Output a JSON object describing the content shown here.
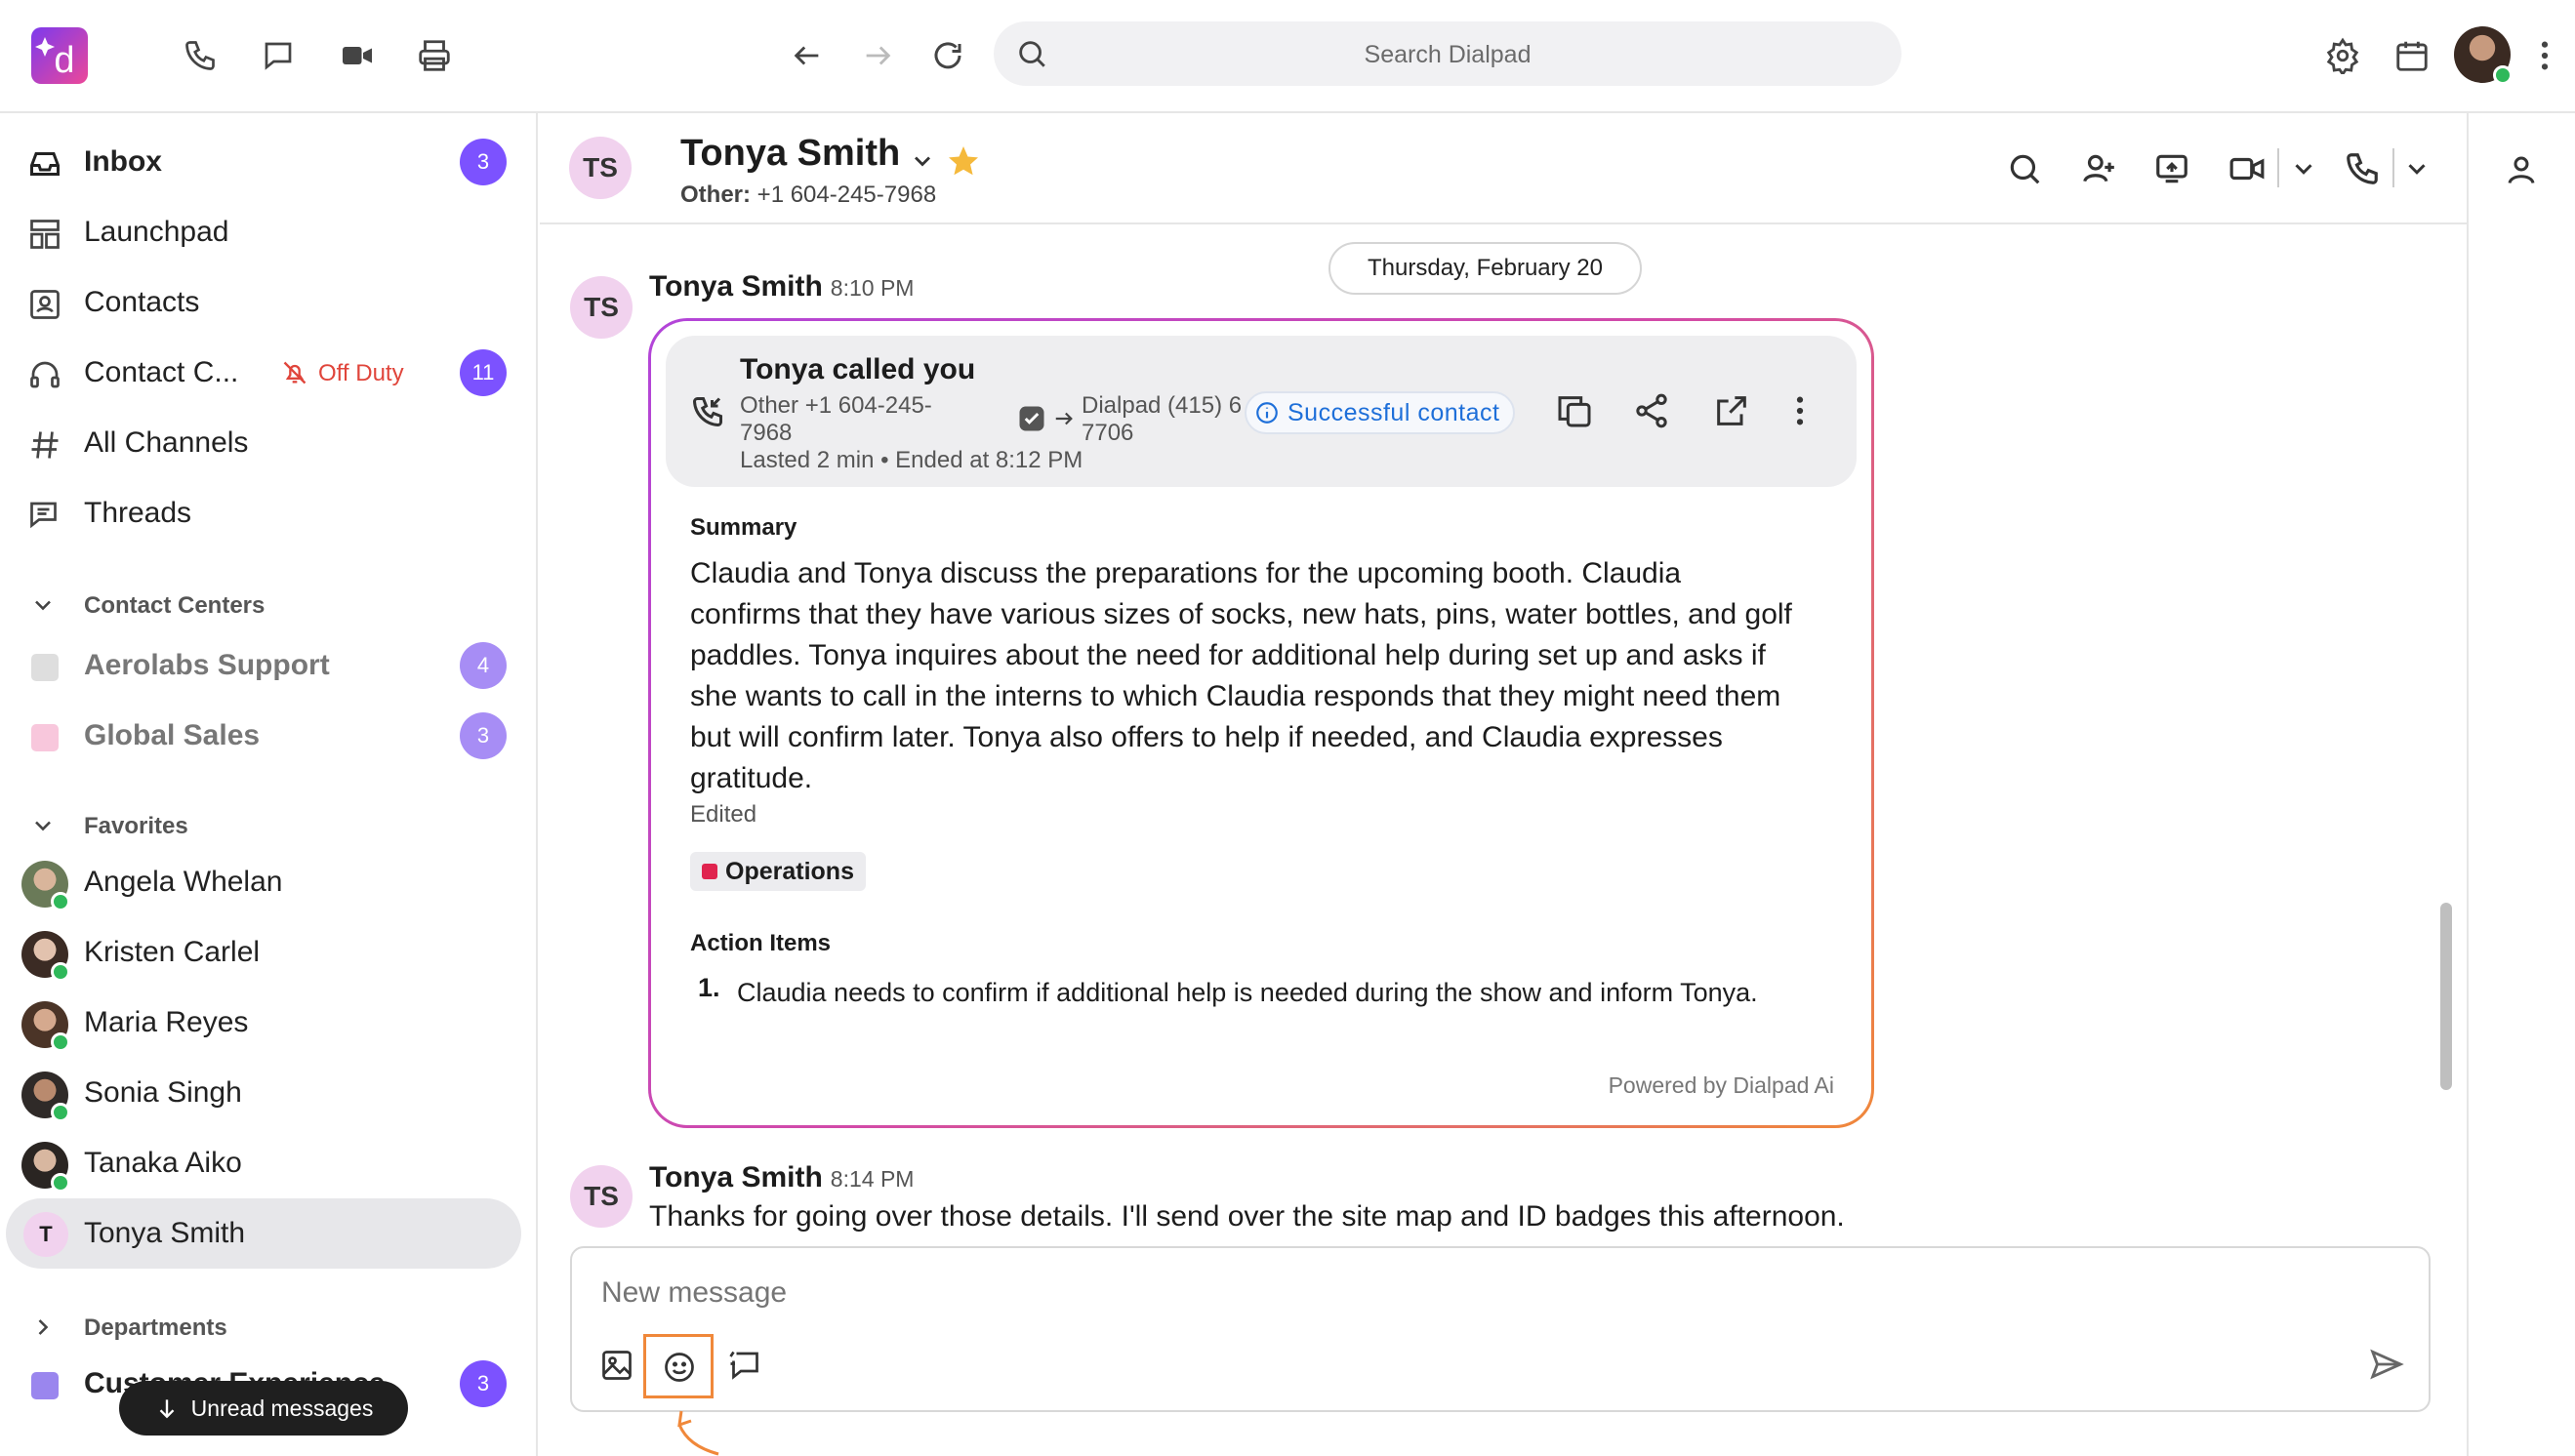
{
  "search": {
    "placeholder": "Search Dialpad"
  },
  "colors": {
    "accent": "#7c52ff",
    "online": "#2fb85a",
    "off_duty": "#e0453b",
    "success": "#1e6fd9",
    "highlight": "#f0883a"
  },
  "icons": {
    "top_left": [
      "dialpad-logo-icon",
      "phone-icon",
      "message-icon",
      "video-icon",
      "print-icon"
    ],
    "nav": [
      "back-arrow-icon",
      "forward-arrow-icon",
      "refresh-icon",
      "search-icon"
    ],
    "top_right": [
      "settings-icon",
      "calendar-icon",
      "user-avatar",
      "more-vertical-icon"
    ]
  },
  "sidebar": {
    "nav": [
      {
        "label": "Inbox",
        "badge": "3",
        "bold": true
      },
      {
        "label": "Launchpad"
      },
      {
        "label": "Contacts"
      },
      {
        "label": "Contact C...",
        "status": "Off Duty",
        "badge": "11"
      },
      {
        "label": "All Channels"
      },
      {
        "label": "Threads"
      }
    ],
    "contact_centers": {
      "title": "Contact Centers",
      "items": [
        {
          "label": "Aerolabs Support",
          "badge": "4",
          "color": "#dedede"
        },
        {
          "label": "Global Sales",
          "badge": "3",
          "color": "#f8c7dc"
        }
      ]
    },
    "favorites": {
      "title": "Favorites",
      "items": [
        {
          "label": "Angela Whelan"
        },
        {
          "label": "Kristen Carlel"
        },
        {
          "label": "Maria Reyes"
        },
        {
          "label": "Sonia Singh"
        },
        {
          "label": "Tanaka Aiko"
        },
        {
          "label": "Tonya Smith",
          "initial": "T",
          "selected": true
        }
      ]
    },
    "departments": {
      "title": "Departments",
      "items": [
        {
          "label": "Customer Experience",
          "badge": "3",
          "color": "#9a86ee"
        }
      ]
    },
    "unread_pill": "Unread messages"
  },
  "header": {
    "initials": "TS",
    "name": "Tonya Smith",
    "sub_label": "Other:",
    "sub_value": "+1 604-245-7968"
  },
  "chat": {
    "date_chip": "Thursday, February 20",
    "messages": [
      {
        "initials": "TS",
        "name": "Tonya Smith",
        "time": "8:10 PM"
      },
      {
        "initials": "TS",
        "name": "Tonya Smith",
        "time": "8:14 PM",
        "text": "Thanks for going over those details. I'll send over the site map and ID badges this afternoon."
      }
    ],
    "call_card": {
      "title": "Tonya called you",
      "from_line1": "Other +1 604-245-",
      "from_line2": "7968",
      "to_line1": "Dialpad (415) 6",
      "to_line2": "7706",
      "duration": "Lasted 2 min • Ended at 8:12 PM",
      "status": "Successful contact",
      "summary_title": "Summary",
      "summary": "Claudia and Tonya discuss the preparations for the upcoming booth. Claudia confirms that they have various sizes of socks, new hats, pins, water bottles, and golf paddles. Tonya inquires about the need for additional help during set up and asks if she wants to call in the interns to which Claudia responds that they might need them but will confirm later. Tonya also offers to help if needed, and Claudia expresses gratitude.",
      "edited": "Edited",
      "tag": "Operations",
      "action_title": "Action Items",
      "action_items": [
        {
          "num": "1.",
          "text": "Claudia needs to confirm if additional help is needed during the show and inform Tonya."
        }
      ],
      "powered_by": "Powered by Dialpad Ai"
    }
  },
  "composer": {
    "placeholder": "New message"
  }
}
